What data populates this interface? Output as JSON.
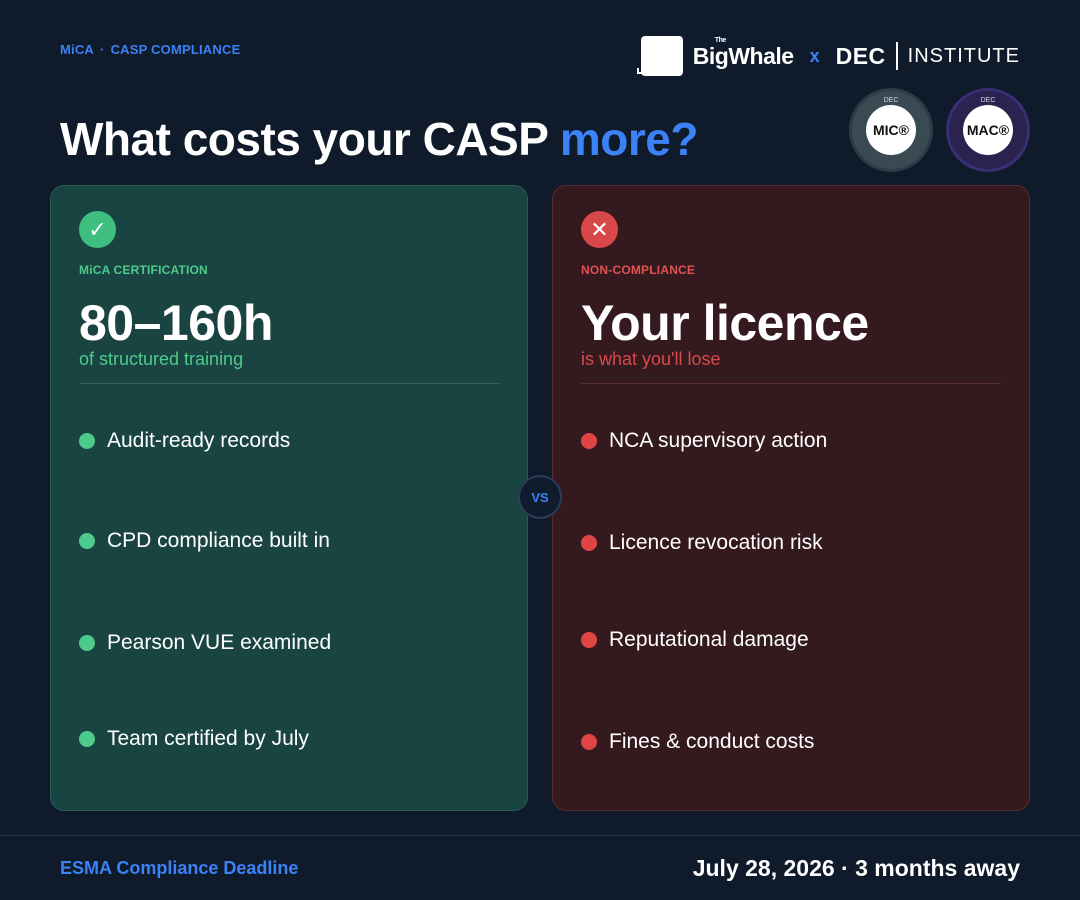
{
  "eyebrow": {
    "tag": "MiCA",
    "separator": "·",
    "topic": "CASP COMPLIANCE"
  },
  "brand": {
    "the": "The",
    "name": "BigWhale",
    "x": "x",
    "dec": "DEC",
    "institute": "INSTITUTE"
  },
  "headline": {
    "main": "What costs your CASP ",
    "accent": "more?"
  },
  "badges": {
    "mic": {
      "top": "DEC",
      "label": "MIC®"
    },
    "mac": {
      "top": "DEC",
      "label": "MAC®"
    }
  },
  "left": {
    "icon": "check-icon",
    "icon_glyph": "✓",
    "label": "MiCA CERTIFICATION",
    "big": "80–160h",
    "sub": "of structured training",
    "items": [
      "Audit-ready records",
      "CPD compliance built in",
      "Pearson VUE examined",
      "Team certified by July"
    ]
  },
  "right": {
    "icon": "close-icon",
    "icon_glyph": "✕",
    "label": "NON-COMPLIANCE",
    "big": "Your licence",
    "sub": "is what you'll lose",
    "items": [
      "NCA supervisory action",
      "Licence revocation risk",
      "Reputational damage",
      "Fines & conduct costs"
    ]
  },
  "vs": "VS",
  "footer": {
    "left": "ESMA Compliance Deadline",
    "right": "July 28, 2026 · 3 months away"
  },
  "colors": {
    "accent": "#3b82f6",
    "positive": "#4ecb8c",
    "negative": "#e04545",
    "background": "#0f1a2b"
  }
}
